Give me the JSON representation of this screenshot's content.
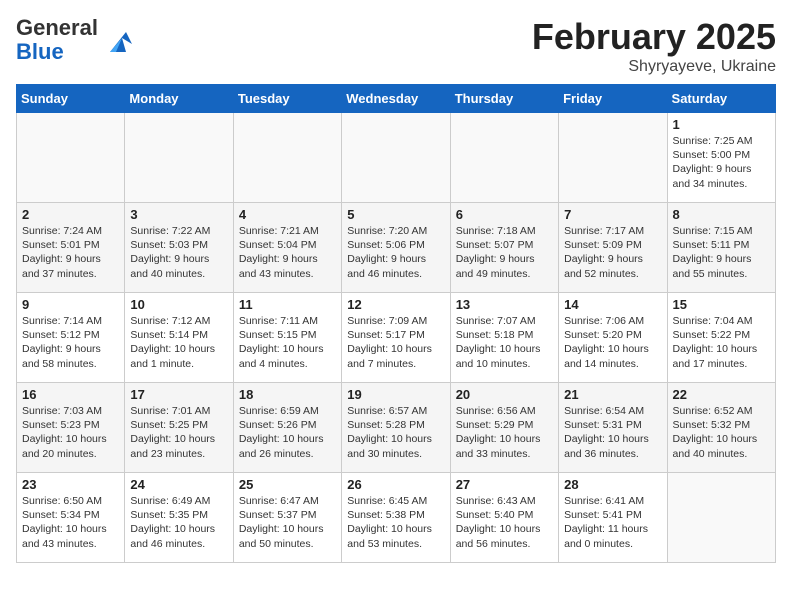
{
  "logo": {
    "general": "General",
    "blue": "Blue"
  },
  "header": {
    "title": "February 2025",
    "subtitle": "Shyryayeve, Ukraine"
  },
  "weekdays": [
    "Sunday",
    "Monday",
    "Tuesday",
    "Wednesday",
    "Thursday",
    "Friday",
    "Saturday"
  ],
  "weeks": [
    [
      {
        "day": "",
        "info": ""
      },
      {
        "day": "",
        "info": ""
      },
      {
        "day": "",
        "info": ""
      },
      {
        "day": "",
        "info": ""
      },
      {
        "day": "",
        "info": ""
      },
      {
        "day": "",
        "info": ""
      },
      {
        "day": "1",
        "info": "Sunrise: 7:25 AM\nSunset: 5:00 PM\nDaylight: 9 hours and 34 minutes."
      }
    ],
    [
      {
        "day": "2",
        "info": "Sunrise: 7:24 AM\nSunset: 5:01 PM\nDaylight: 9 hours and 37 minutes."
      },
      {
        "day": "3",
        "info": "Sunrise: 7:22 AM\nSunset: 5:03 PM\nDaylight: 9 hours and 40 minutes."
      },
      {
        "day": "4",
        "info": "Sunrise: 7:21 AM\nSunset: 5:04 PM\nDaylight: 9 hours and 43 minutes."
      },
      {
        "day": "5",
        "info": "Sunrise: 7:20 AM\nSunset: 5:06 PM\nDaylight: 9 hours and 46 minutes."
      },
      {
        "day": "6",
        "info": "Sunrise: 7:18 AM\nSunset: 5:07 PM\nDaylight: 9 hours and 49 minutes."
      },
      {
        "day": "7",
        "info": "Sunrise: 7:17 AM\nSunset: 5:09 PM\nDaylight: 9 hours and 52 minutes."
      },
      {
        "day": "8",
        "info": "Sunrise: 7:15 AM\nSunset: 5:11 PM\nDaylight: 9 hours and 55 minutes."
      }
    ],
    [
      {
        "day": "9",
        "info": "Sunrise: 7:14 AM\nSunset: 5:12 PM\nDaylight: 9 hours and 58 minutes."
      },
      {
        "day": "10",
        "info": "Sunrise: 7:12 AM\nSunset: 5:14 PM\nDaylight: 10 hours and 1 minute."
      },
      {
        "day": "11",
        "info": "Sunrise: 7:11 AM\nSunset: 5:15 PM\nDaylight: 10 hours and 4 minutes."
      },
      {
        "day": "12",
        "info": "Sunrise: 7:09 AM\nSunset: 5:17 PM\nDaylight: 10 hours and 7 minutes."
      },
      {
        "day": "13",
        "info": "Sunrise: 7:07 AM\nSunset: 5:18 PM\nDaylight: 10 hours and 10 minutes."
      },
      {
        "day": "14",
        "info": "Sunrise: 7:06 AM\nSunset: 5:20 PM\nDaylight: 10 hours and 14 minutes."
      },
      {
        "day": "15",
        "info": "Sunrise: 7:04 AM\nSunset: 5:22 PM\nDaylight: 10 hours and 17 minutes."
      }
    ],
    [
      {
        "day": "16",
        "info": "Sunrise: 7:03 AM\nSunset: 5:23 PM\nDaylight: 10 hours and 20 minutes."
      },
      {
        "day": "17",
        "info": "Sunrise: 7:01 AM\nSunset: 5:25 PM\nDaylight: 10 hours and 23 minutes."
      },
      {
        "day": "18",
        "info": "Sunrise: 6:59 AM\nSunset: 5:26 PM\nDaylight: 10 hours and 26 minutes."
      },
      {
        "day": "19",
        "info": "Sunrise: 6:57 AM\nSunset: 5:28 PM\nDaylight: 10 hours and 30 minutes."
      },
      {
        "day": "20",
        "info": "Sunrise: 6:56 AM\nSunset: 5:29 PM\nDaylight: 10 hours and 33 minutes."
      },
      {
        "day": "21",
        "info": "Sunrise: 6:54 AM\nSunset: 5:31 PM\nDaylight: 10 hours and 36 minutes."
      },
      {
        "day": "22",
        "info": "Sunrise: 6:52 AM\nSunset: 5:32 PM\nDaylight: 10 hours and 40 minutes."
      }
    ],
    [
      {
        "day": "23",
        "info": "Sunrise: 6:50 AM\nSunset: 5:34 PM\nDaylight: 10 hours and 43 minutes."
      },
      {
        "day": "24",
        "info": "Sunrise: 6:49 AM\nSunset: 5:35 PM\nDaylight: 10 hours and 46 minutes."
      },
      {
        "day": "25",
        "info": "Sunrise: 6:47 AM\nSunset: 5:37 PM\nDaylight: 10 hours and 50 minutes."
      },
      {
        "day": "26",
        "info": "Sunrise: 6:45 AM\nSunset: 5:38 PM\nDaylight: 10 hours and 53 minutes."
      },
      {
        "day": "27",
        "info": "Sunrise: 6:43 AM\nSunset: 5:40 PM\nDaylight: 10 hours and 56 minutes."
      },
      {
        "day": "28",
        "info": "Sunrise: 6:41 AM\nSunset: 5:41 PM\nDaylight: 11 hours and 0 minutes."
      },
      {
        "day": "",
        "info": ""
      }
    ]
  ]
}
